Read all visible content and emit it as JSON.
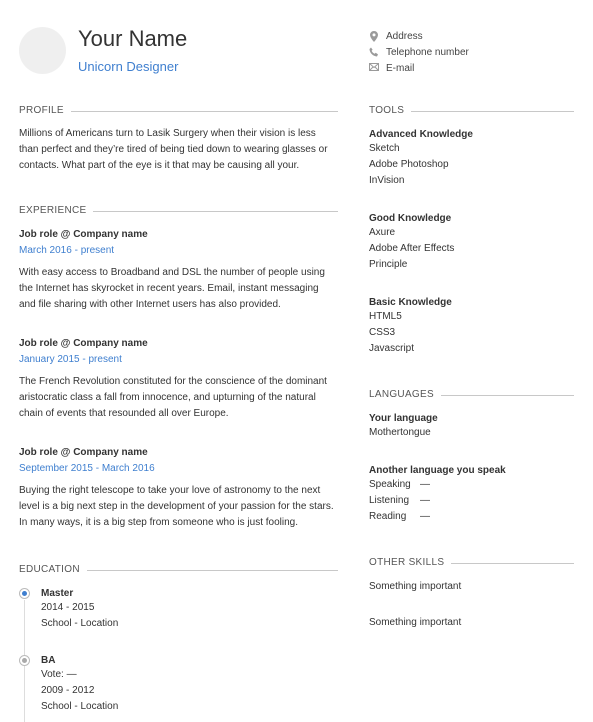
{
  "header": {
    "name": "Your Name",
    "title": "Unicorn Designer",
    "contacts": [
      {
        "icon": "map-pin-icon",
        "label": "Address"
      },
      {
        "icon": "phone-icon",
        "label": "Telephone number"
      },
      {
        "icon": "envelope-icon",
        "label": "E-mail"
      }
    ]
  },
  "profile": {
    "heading": "PROFILE",
    "lines": [
      "Millions of Americans turn to Lasik Surgery when their vision is less",
      "than perfect and they’re tired of being tied down to wearing glasses or",
      "contacts. What part of the eye is it that may be causing all your."
    ]
  },
  "experience": {
    "heading": "EXPERIENCE",
    "jobs": [
      {
        "title": "Job role @ Company name",
        "date": "March 2016 - present",
        "lines": [
          "With easy access to Broadband and DSL the number of people using",
          "the Internet has skyrocket in recent years. Email, instant messaging",
          "and file sharing with other Internet users has also provided."
        ]
      },
      {
        "title": "Job role @ Company name",
        "date": "January 2015 - present",
        "lines": [
          "The French Revolution constituted for the conscience of the dominant",
          "aristocratic class a fall from innocence, and upturning of the natural",
          "chain of events that resounded all over Europe."
        ]
      },
      {
        "title": "Job role @ Company name",
        "date": "September 2015 - March 2016",
        "lines": [
          "Buying the right telescope to take your love of astronomy to the next",
          "level is a big next step in the development of your passion for the stars.",
          "In many ways, it is a big step from someone who is just fooling."
        ]
      }
    ]
  },
  "education": {
    "heading": "EDUCATION",
    "entries": [
      {
        "degree": "Master",
        "lines": [
          "2014 - 2015",
          "School - Location"
        ],
        "active": true
      },
      {
        "degree": "BA",
        "lines": [
          "Vote: —",
          "2009 - 2012",
          "School - Location"
        ],
        "active": false
      }
    ]
  },
  "tools": {
    "heading": "TOOLS",
    "groups": [
      {
        "label": "Advanced Knowledge",
        "items": [
          "Sketch",
          "Adobe Photoshop",
          "InVision"
        ]
      },
      {
        "label": "Good Knowledge",
        "items": [
          "Axure",
          "Adobe After Effects",
          "Principle"
        ]
      },
      {
        "label": "Basic Knowledge",
        "items": [
          "HTML5",
          "CSS3",
          "Javascript"
        ]
      }
    ]
  },
  "languages": {
    "heading": "LANGUAGES",
    "native_label": "Your language",
    "native_value": "Mothertongue",
    "other_label": "Another language you speak",
    "skills": [
      {
        "name": "Speaking",
        "level": "—"
      },
      {
        "name": "Listening",
        "level": "—"
      },
      {
        "name": "Reading",
        "level": "—"
      }
    ]
  },
  "other_skills": {
    "heading": "OTHER SKILLS",
    "items": [
      "Something important",
      "Something important"
    ]
  },
  "colors": {
    "accent": "#3f7fcf",
    "muted": "#999999",
    "rule": "#c8c8c8"
  }
}
